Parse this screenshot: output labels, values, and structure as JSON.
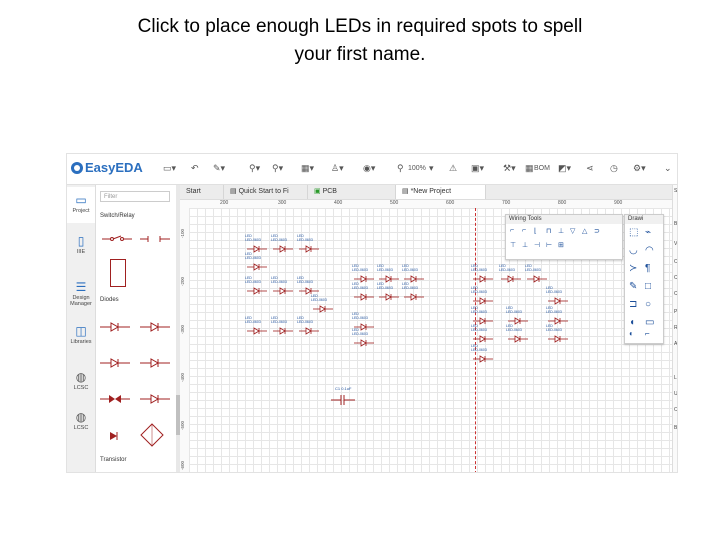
{
  "slide": {
    "instruction_line1": "Click to place enough LEDs in required spots to spell",
    "instruction_line2": "your first name."
  },
  "app": {
    "brand": "EasyEDA",
    "zoom": "100%",
    "toolbar_label": "BOM"
  },
  "left_nav": [
    {
      "icon": "folder-icon",
      "label": "Project"
    },
    {
      "icon": "component-icon",
      "label": "IIIE"
    },
    {
      "icon": "design-manager-icon",
      "label": "Design Manager"
    },
    {
      "icon": "library-icon",
      "label": "Libraries"
    },
    {
      "icon": "jlc-icon",
      "label": "LCSC"
    },
    {
      "icon": "lcsc-icon",
      "label": "LCSC"
    }
  ],
  "library": {
    "filter_placeholder": "Filter",
    "sections": [
      "Switch/Relay",
      "Diodes",
      "Transistor"
    ]
  },
  "tabs": [
    "Start",
    "Quick Start to Fi",
    "PCB",
    "*New Project"
  ],
  "ruler_top": [
    "200",
    "300",
    "400",
    "500",
    "600",
    "700",
    "800",
    "900"
  ],
  "ruler_left": [
    "-100",
    "-200",
    "-300",
    "-400",
    "-500",
    "-600"
  ],
  "wiring_tools": {
    "title": "Wiring Tools",
    "tools": [
      "⌐",
      "⌐",
      "⌊",
      "⊓",
      "⊥",
      "▽",
      "△",
      "⊃",
      "⊤",
      "⊥",
      "⊣",
      "⊢",
      "⊞"
    ]
  },
  "drawing_tools": {
    "title": "Drawi",
    "tools": [
      "⬚",
      "⌁",
      "◡",
      "◠",
      "≻",
      "¶",
      "✎",
      "□",
      "⊐",
      "○",
      "◖",
      "▭",
      "◐",
      "⌐"
    ]
  },
  "right_sidebar": [
    "S",
    "B",
    "V",
    "O",
    "C",
    "C",
    "P",
    "R",
    "A",
    "L",
    "U",
    "O",
    "B"
  ],
  "schematic": {
    "led_label_top": "LED",
    "led_label_bottom": "LED-0603",
    "capacitor_label": "C1 0.1uF"
  }
}
